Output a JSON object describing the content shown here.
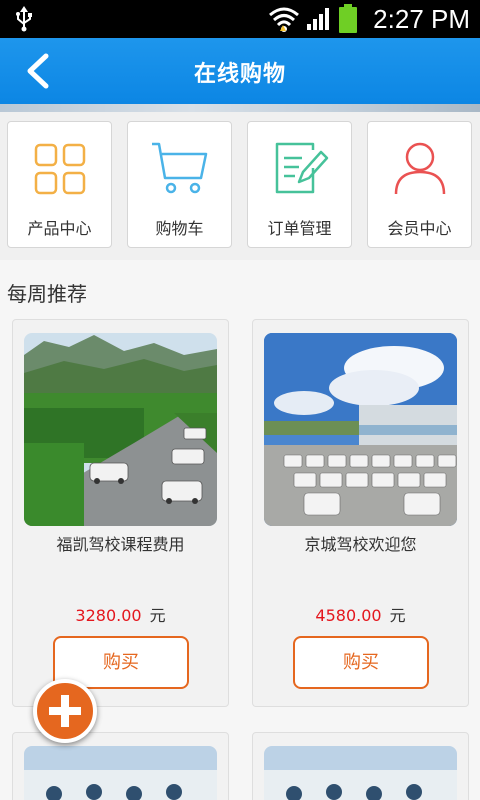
{
  "status_bar": {
    "time": "2:27 PM",
    "icons": [
      "usb-icon",
      "wifi-icon",
      "signal-icon",
      "battery-icon"
    ]
  },
  "header": {
    "title": "在线购物",
    "back_icon": "chevron-left-icon",
    "background": "#1a8ee8"
  },
  "quick_nav": [
    {
      "label": "产品中心",
      "icon": "grid-icon",
      "color": "#f3b046"
    },
    {
      "label": "购物车",
      "icon": "cart-icon",
      "color": "#4ab3e8"
    },
    {
      "label": "订单管理",
      "icon": "edit-document-icon",
      "color": "#46c29a"
    },
    {
      "label": "会员中心",
      "icon": "user-icon",
      "color": "#ea5252"
    }
  ],
  "weekly": {
    "title": "每周推荐",
    "products": [
      {
        "name": "福凯驾校课程费用",
        "price": "3280.00",
        "currency": "元",
        "buy_label": "购买"
      },
      {
        "name": "京城驾校欢迎您",
        "price": "4580.00",
        "currency": "元",
        "buy_label": "购买"
      }
    ]
  },
  "fab": {
    "icon": "plus-icon",
    "color": "#e5671f"
  }
}
